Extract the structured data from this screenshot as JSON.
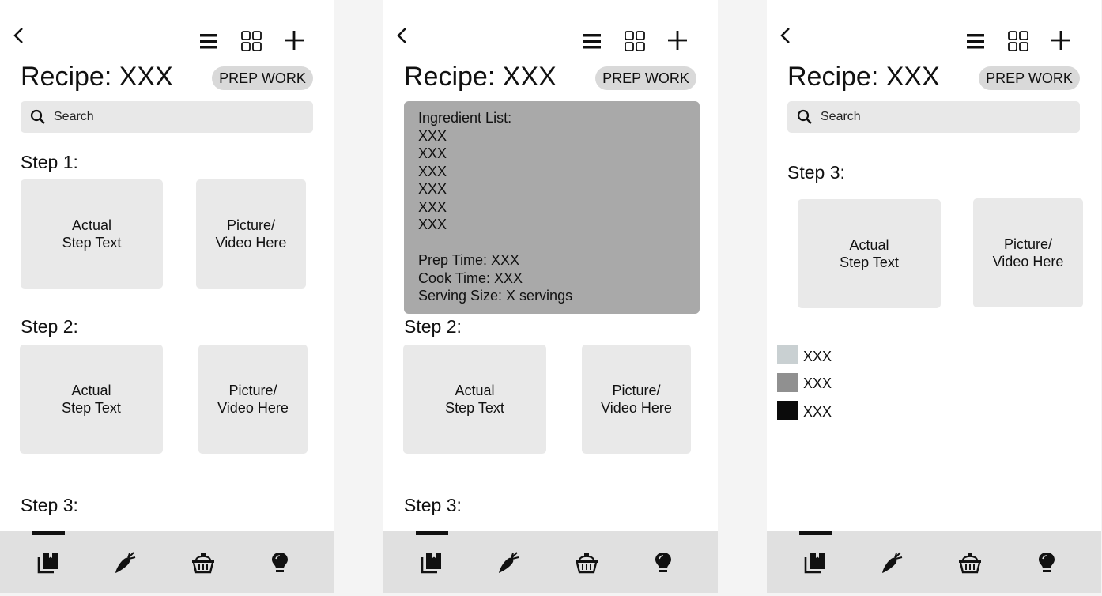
{
  "header": {
    "title": "Recipe: XXX",
    "prep_button": "PREP WORK",
    "search_placeholder": "Search"
  },
  "cards": {
    "step_text": "Actual\nStep Text",
    "media_text": "Picture/\nVideo Here"
  },
  "panel1": {
    "steps": [
      "Step 1:",
      "Step 2:",
      "Step 3:"
    ]
  },
  "panel2": {
    "ingredients": "Ingredient List:\nXXX\nXXX\nXXX\nXXX\nXXX\nXXX\n\nPrep Time: XXX\nCook Time: XXX\nServing Size: X servings",
    "steps": [
      "Step 2:",
      "Step 3:"
    ]
  },
  "panel3": {
    "steps": [
      "Step 3:"
    ],
    "legend": [
      {
        "label": "XXX",
        "color": "#c9d0d2"
      },
      {
        "label": "XXX",
        "color": "#909090"
      },
      {
        "label": "XXX",
        "color": "#0b0b0b"
      }
    ]
  },
  "nav": {
    "items": [
      "recipes",
      "ingredients",
      "shopping",
      "tips"
    ],
    "active_index": 0
  }
}
